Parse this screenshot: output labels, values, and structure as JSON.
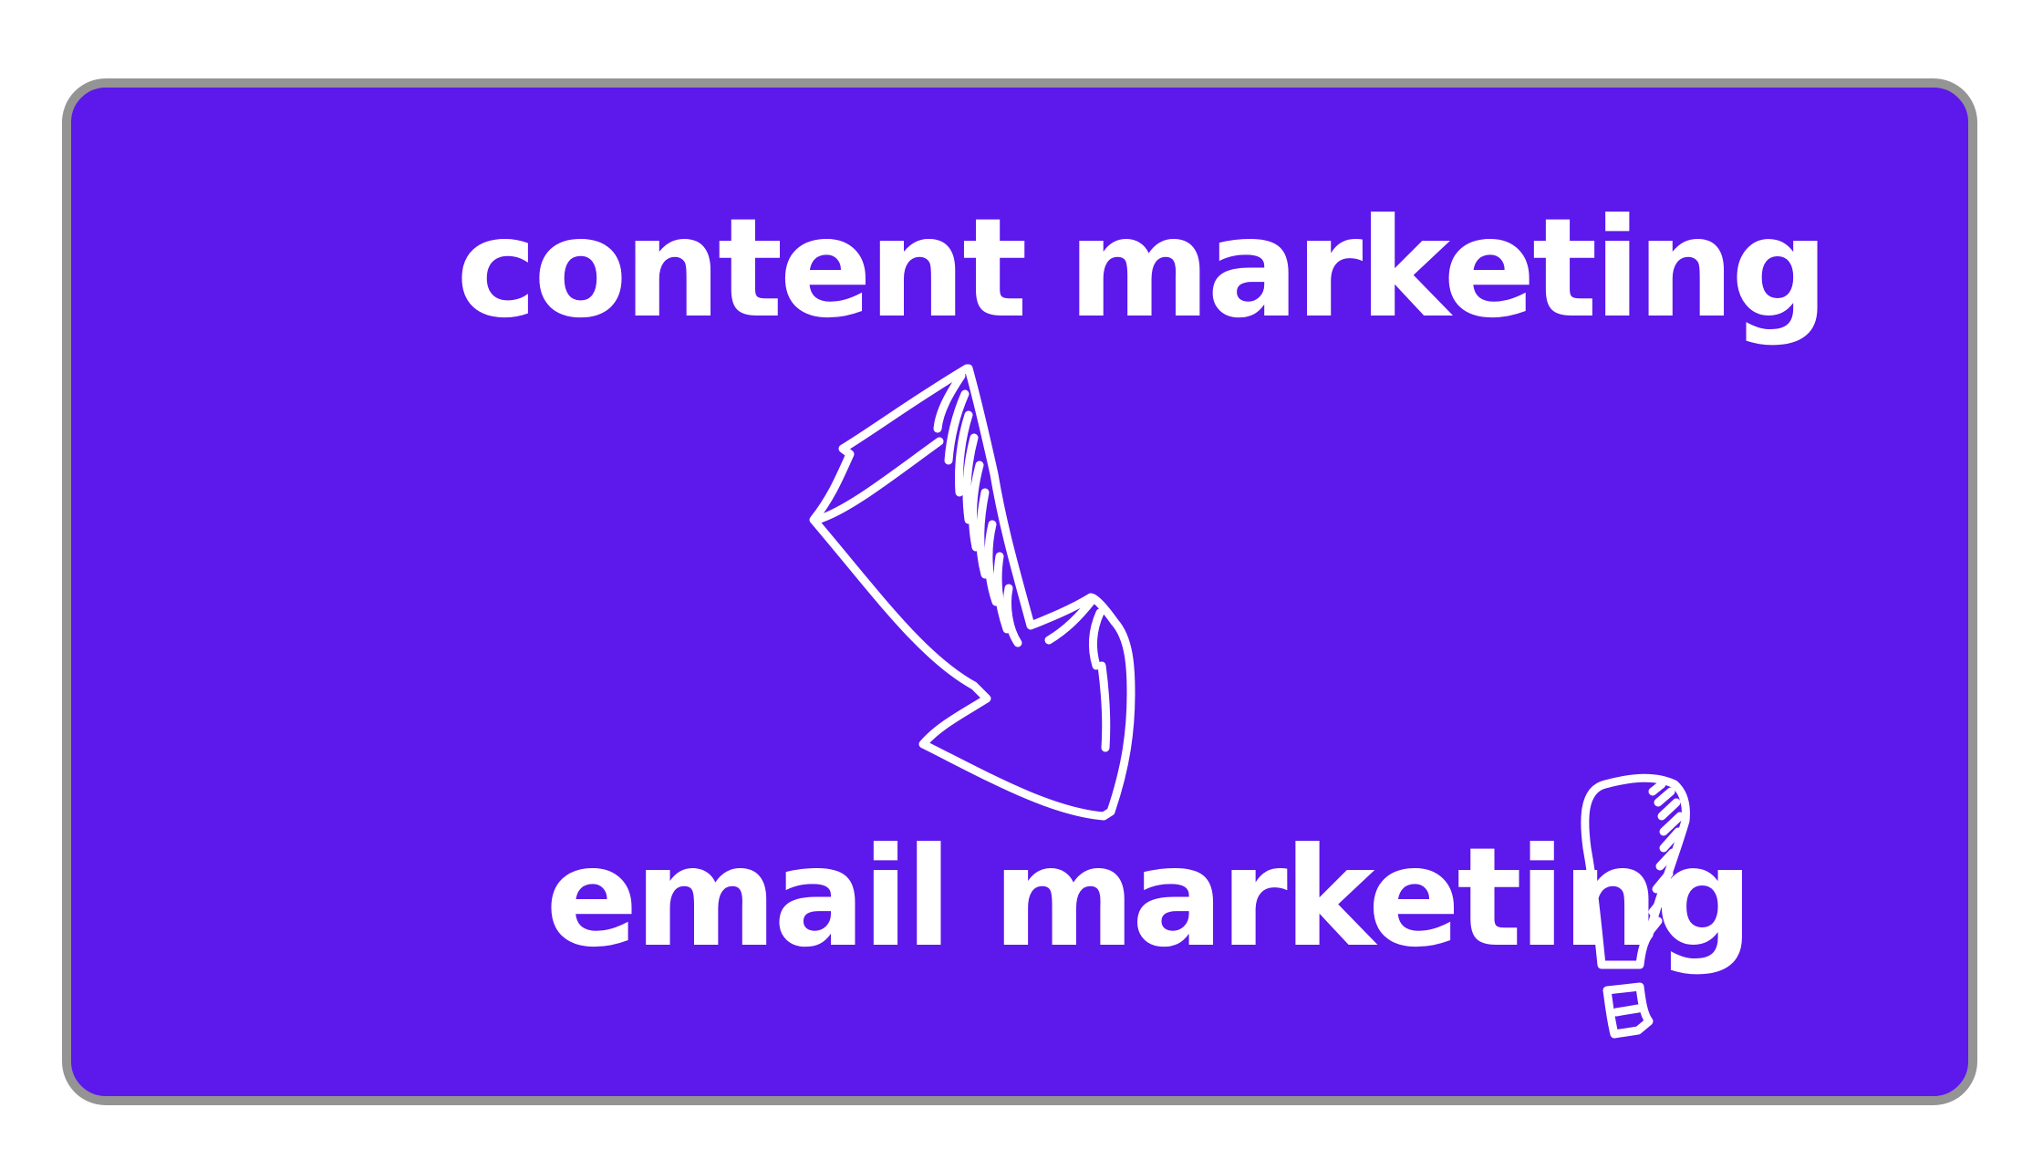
{
  "graphic": {
    "headline_top": "content marketing",
    "headline_bottom": "email marketing",
    "colors": {
      "background": "#5d18eb",
      "border": "#949494",
      "text": "#ffffff",
      "page": "#ffffff"
    },
    "decorations": [
      "hand-drawn-arrow-icon",
      "hand-drawn-exclamation-icon"
    ]
  }
}
